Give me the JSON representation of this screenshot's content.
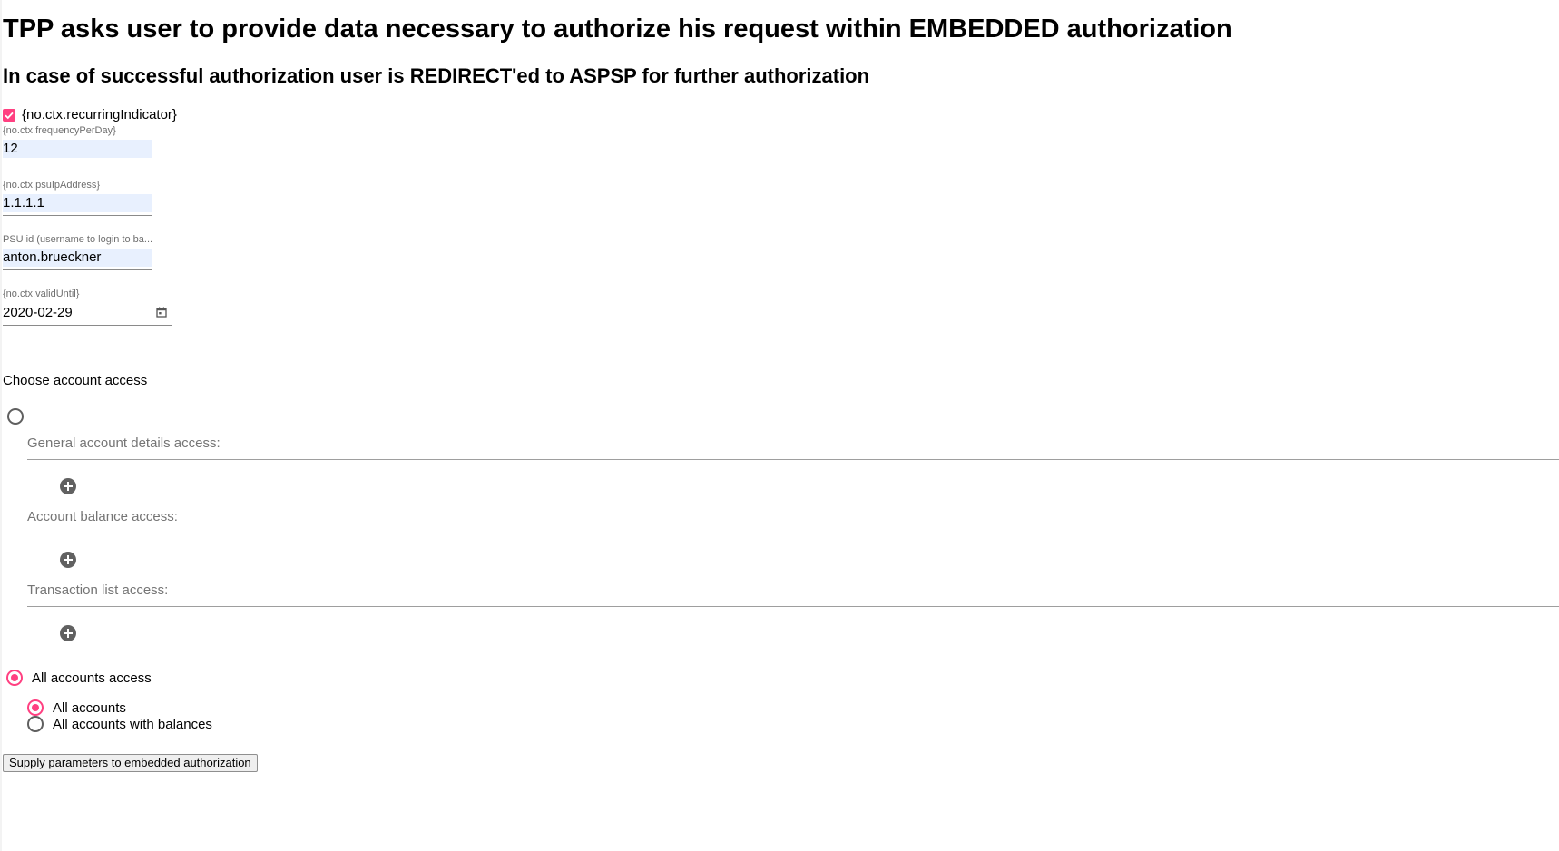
{
  "headings": {
    "title": "TPP asks user to provide data necessary to authorize his request within EMBEDDED authorization",
    "subtitle": "In case of successful authorization user is REDIRECT'ed to ASPSP for further authorization"
  },
  "recurring": {
    "label": "{no.ctx.recurringIndicator}",
    "checked": true
  },
  "fields": {
    "frequency": {
      "label": "{no.ctx.frequencyPerDay}",
      "value": "12"
    },
    "psu_ip": {
      "label": "{no.ctx.psuIpAddress}",
      "value": "1.1.1.1"
    },
    "psu_id": {
      "label": "PSU id (username to login to ba...",
      "value": "anton.brueckner"
    },
    "valid_until": {
      "label": "{no.ctx.validUntil}",
      "value": "2020-02-29"
    }
  },
  "access": {
    "heading": "Choose account access",
    "sections": [
      {
        "title": "General account details access:"
      },
      {
        "title": "Account balance access:"
      },
      {
        "title": "Transaction list access:"
      }
    ],
    "all_accounts_access": "All accounts access",
    "options": [
      {
        "label": "All accounts",
        "selected": true
      },
      {
        "label": "All accounts with balances",
        "selected": false
      }
    ]
  },
  "submit_label": "Supply parameters to embedded authorization",
  "colors": {
    "accent": "#ff4081",
    "autofill": "#e8f0fe"
  },
  "icons": {
    "checkbox": "check-icon",
    "calendar": "calendar-icon",
    "add": "add-circle-icon"
  }
}
